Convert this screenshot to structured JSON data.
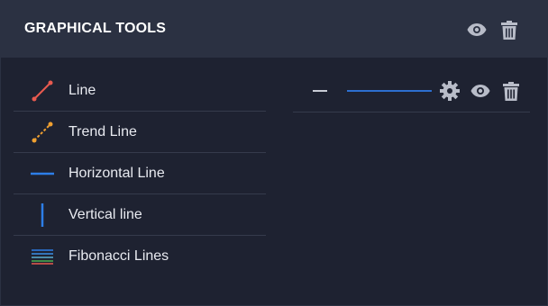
{
  "header": {
    "title": "GRAPHICAL TOOLS",
    "actions": [
      {
        "icon": "eye-icon"
      },
      {
        "icon": "trash-icon"
      }
    ]
  },
  "tools": [
    {
      "label": "Line",
      "icon": "line-icon",
      "color": "#e85a4f"
    },
    {
      "label": "Trend Line",
      "icon": "trend-line-icon",
      "color": "#f0a030"
    },
    {
      "label": "Horizontal Line",
      "icon": "horizontal-line-icon",
      "color": "#2d7ee8"
    },
    {
      "label": "Vertical line",
      "icon": "vertical-line-icon",
      "color": "#2d7ee8"
    },
    {
      "label": "Fibonacci Lines",
      "icon": "fibonacci-lines-icon",
      "color": "#2d7ee8"
    }
  ],
  "active_drawing": {
    "line_color": "#2d6fd0",
    "actions": [
      {
        "icon": "gear-icon"
      },
      {
        "icon": "eye-icon"
      },
      {
        "icon": "trash-icon"
      }
    ]
  },
  "colors": {
    "background": "#1e2231",
    "header": "#2b3142",
    "icon_gray": "#b8bcc8"
  }
}
